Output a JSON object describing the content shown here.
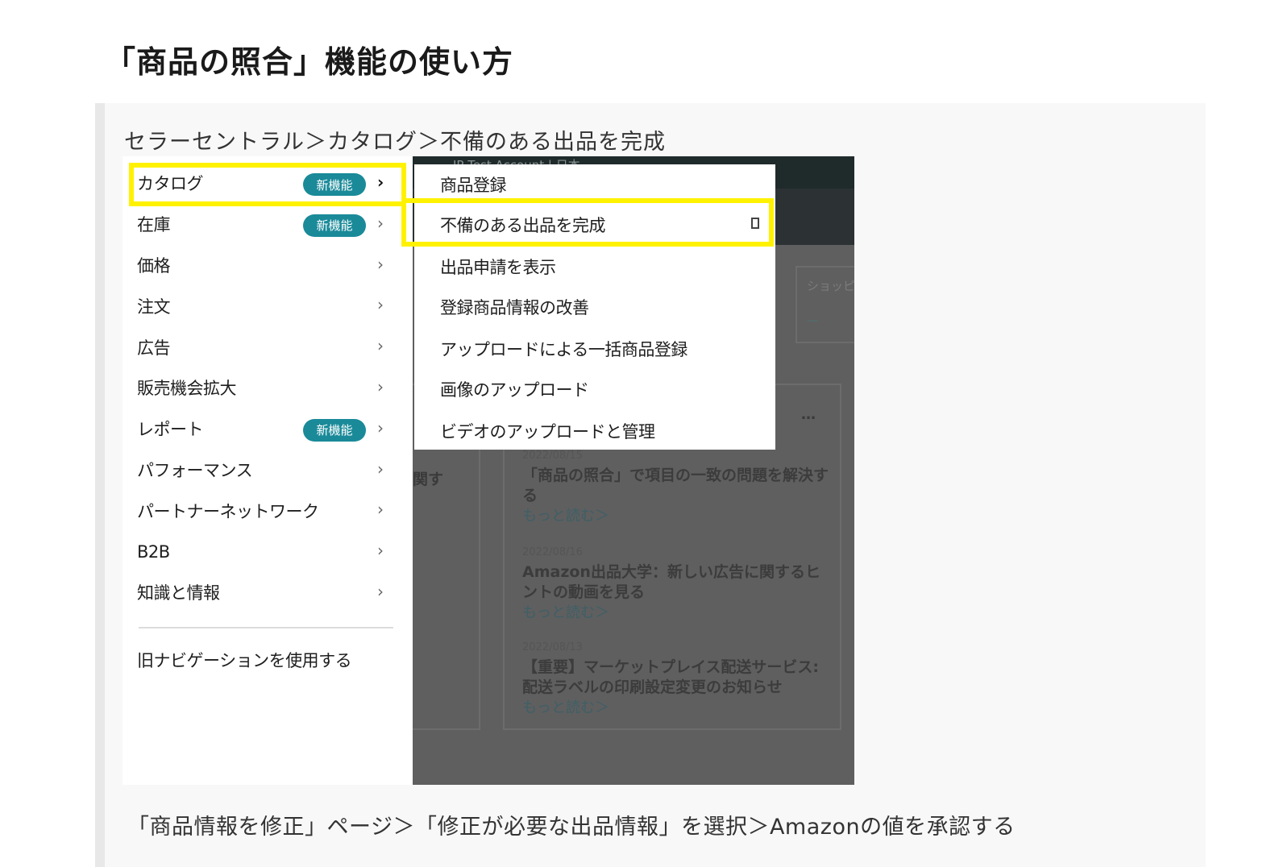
{
  "page_title": "「商品の照合」機能の使い方",
  "breadcrumb": "セラーセントラル＞カタログ＞不備のある出品を完成",
  "bottom_text": "「商品情報を修正」ページ＞「修正が必要な出品情報」を選択＞Amazonの値を承認する",
  "screenshot": {
    "account_label": "JP Test Account | 日本",
    "main_menu": {
      "items": [
        {
          "label": "カタログ",
          "badge": "新機能",
          "active": true
        },
        {
          "label": "在庫",
          "badge": "新機能"
        },
        {
          "label": "価格"
        },
        {
          "label": "注文"
        },
        {
          "label": "広告"
        },
        {
          "label": "販売機会拡大"
        },
        {
          "label": "レポート",
          "badge": "新機能"
        },
        {
          "label": "パフォーマンス"
        },
        {
          "label": "パートナーネットワーク"
        },
        {
          "label": "B2B"
        },
        {
          "label": "知識と情報"
        }
      ],
      "legacy_nav": "旧ナビゲーションを使用する"
    },
    "submenu": {
      "items": [
        "商品登録",
        "不備のある出品を完成",
        "出品申請を表示",
        "登録商品情報の改善",
        "アップロードによる一括商品登録",
        "画像のアップロード",
        "ビデオのアップロードと管理"
      ]
    },
    "background": {
      "card_label": "ショッピ",
      "card_dash": "—",
      "fragment_text": "関す",
      "more_menu": "…",
      "news": [
        {
          "date": "2022/08/15",
          "headline": "「商品の照合」で項目の一致の問題を解決する",
          "more": "もっと読む＞"
        },
        {
          "date": "2022/08/16",
          "headline": "Amazon出品大学：新しい広告に関するヒントの動画を見る",
          "more": "もっと読む＞"
        },
        {
          "date": "2022/08/13",
          "headline": "【重要】マーケットプレイス配送サービス: 配送ラベルの印刷設定変更のお知らせ",
          "more": "もっと読む＞"
        }
      ]
    }
  },
  "colors": {
    "highlight": "#fff200",
    "badge": "#1a8a99",
    "overlay": "#5f5f5f"
  }
}
